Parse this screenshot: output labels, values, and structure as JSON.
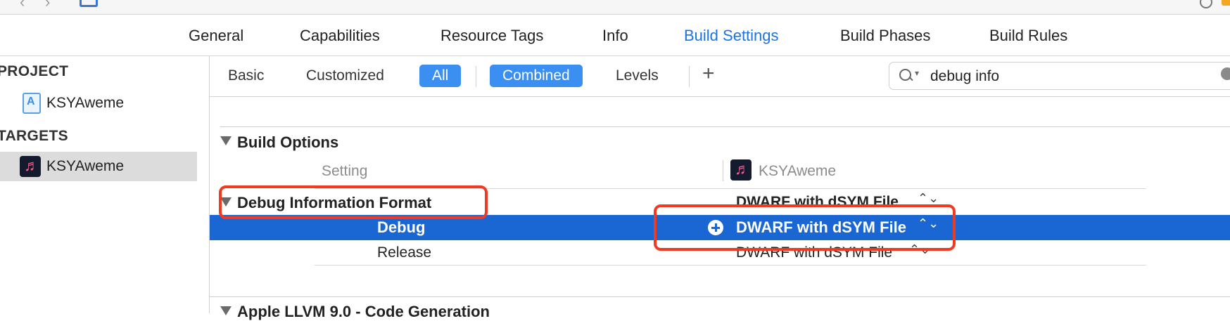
{
  "window": {
    "nav": {
      "back_glyph": "‹",
      "forward_glyph": "›"
    }
  },
  "tabs": [
    {
      "label": "General",
      "active": false
    },
    {
      "label": "Capabilities",
      "active": false
    },
    {
      "label": "Resource Tags",
      "active": false
    },
    {
      "label": "Info",
      "active": false
    },
    {
      "label": "Build Settings",
      "active": true
    },
    {
      "label": "Build Phases",
      "active": false
    },
    {
      "label": "Build Rules",
      "active": false
    }
  ],
  "navigator": {
    "project_header": "PROJECT",
    "project_name": "KSYAweme",
    "targets_header": "TARGETS",
    "target_name": "KSYAweme"
  },
  "filters": {
    "basic": "Basic",
    "customized": "Customized",
    "all": "All",
    "combined": "Combined",
    "levels": "Levels",
    "add": "+"
  },
  "search": {
    "value": "debug info"
  },
  "section": {
    "title": "Build Options",
    "col_setting": "Setting",
    "col_target": "KSYAweme"
  },
  "setting": {
    "name": "Debug Information Format",
    "value": "DWARF with dSYM File",
    "stepper": "⌃⌄",
    "rows": [
      {
        "config": "Debug",
        "value": "DWARF with dSYM File",
        "selected": true
      },
      {
        "config": "Release",
        "value": "DWARF with dSYM File",
        "selected": false
      }
    ]
  },
  "next_section": {
    "title": "Apple LLVM 9.0 - Code Generation"
  },
  "colors": {
    "accent": "#1a73e8",
    "selection": "#1a66d3",
    "annotation": "#ee3b24"
  }
}
